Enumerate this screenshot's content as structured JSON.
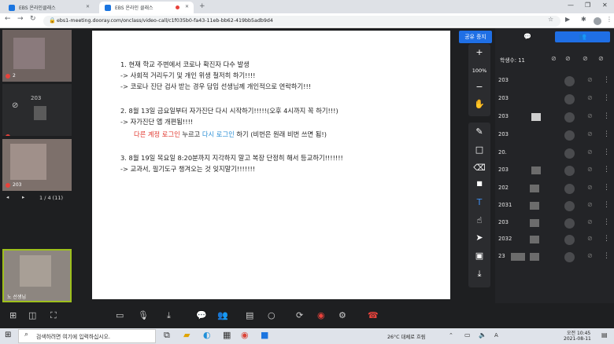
{
  "browser": {
    "tabs": [
      {
        "title": "EBS 온라인클래스"
      },
      {
        "title": "EBS 온라인 클래스"
      }
    ],
    "new_tab_icon": "plus-icon",
    "url": "ebs1-meeting.dooray.com/onclass/video-call/c1f035b0-fa43-11eb-bb62-419bb5adb9d4"
  },
  "participants_left": {
    "thumbs": [
      {
        "name": "2"
      },
      {
        "name": "203"
      },
      {
        "name": "203"
      },
      {
        "name": "노 선생님"
      }
    ],
    "pager": "1 / 4 (11)"
  },
  "board": {
    "lines": [
      "1. 현재 학교 주변에서 코로나 확진자 다수 발생",
      "-> 사회적 거리두기 및 개인 위생 철저히 하기!!!!",
      "-> 코로나 진단 검사 받는 경우 담임 선생님께 개인적으로 연락하기!!!",
      "2. 8월 13일 금요일부터 자가진단 다시 시작하기!!!!!(오후 4시까지 꼭 하기!!!)",
      "-> 자가진단 앱 개편됨!!!!",
      "3. 8월 19일 목요일 8:20분까지 지각하지 말고 복장 단정히 해서 등교하기!!!!!!!",
      "-> 교과서, 필기도구 챙겨오는 것 잊지말기!!!!!!!"
    ],
    "login_line": {
      "red": "다른 계정 로그인",
      "mid": "누르고",
      "blue": "다시 로그인",
      "tail": "하기 (비번은 원래 비번 쓰면 됨!)"
    }
  },
  "share_button": "공유 중지",
  "zoom": "100%",
  "right_panel": {
    "count_label": "학생수: 11",
    "rows": [
      "203",
      "203",
      "203",
      "203",
      "20.",
      "203",
      "202",
      "2031",
      "203",
      "2032",
      "23"
    ]
  },
  "taskbar": {
    "search_placeholder": "검색하려면 여기에 입력하십시오.",
    "weather": "26°C 대체로 흐림",
    "time": "오전 10:45",
    "date": "2021-08-11"
  },
  "colors": {
    "accent": "#1f6fe5",
    "red_text": "#e0362c",
    "blue_text": "#2b8fd6",
    "end_call": "#e8423b"
  }
}
